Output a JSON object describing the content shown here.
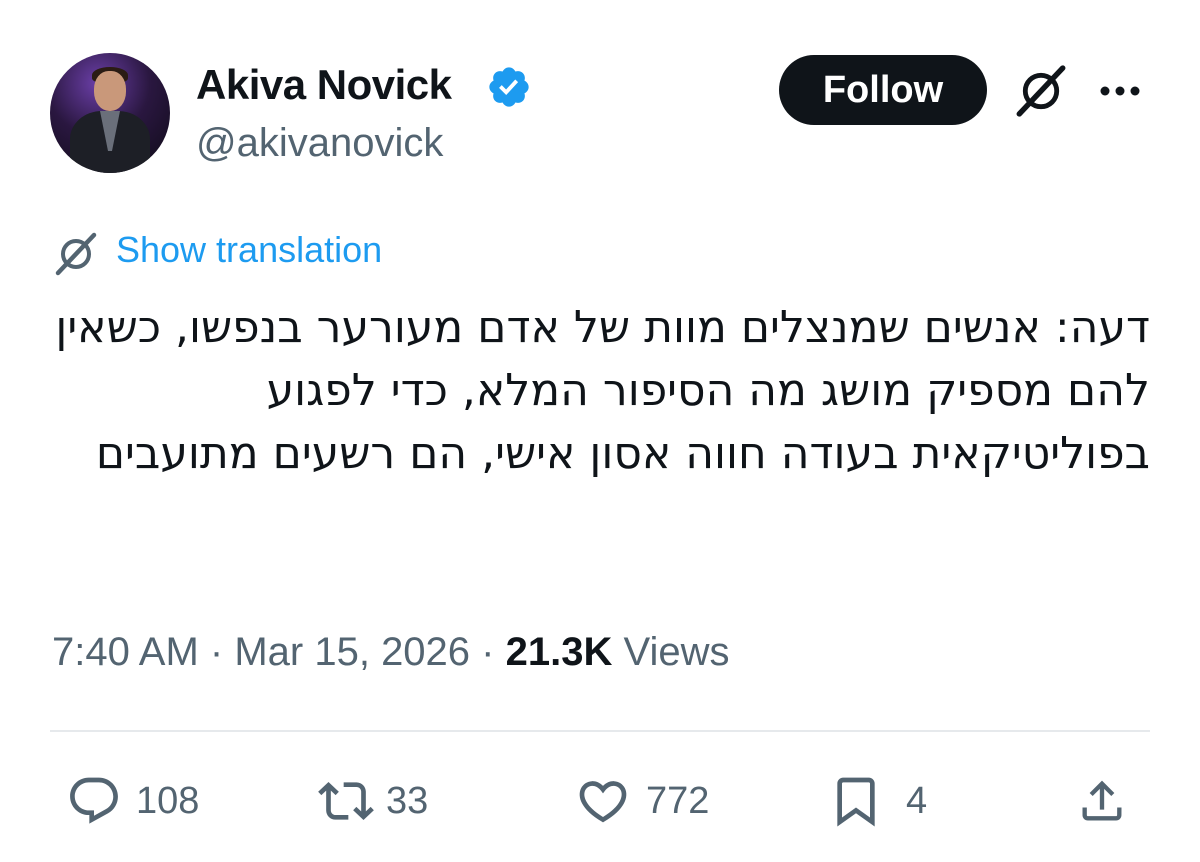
{
  "author": {
    "display_name": "Akiva Novick",
    "handle": "@akivanovick",
    "verified_color": "#1d9bf0"
  },
  "header": {
    "follow_label": "Follow"
  },
  "translation": {
    "label": "Show translation"
  },
  "tweet": {
    "text": "דעה: אנשים שמנצלים מוות של אדם מעורער בנפשו, כשאין להם מספיק מושג מה הסיפור המלא, כדי לפגוע בפוליטיקאית בעודה חווה אסון אישי, הם רשעים מתועבים"
  },
  "meta": {
    "time": "7:40 AM",
    "separator": "·",
    "date": "Mar 15, 2026",
    "views_count": "21.3K",
    "views_label": "Views"
  },
  "actions": {
    "replies": "108",
    "reposts": "33",
    "likes": "772",
    "bookmarks": "4"
  },
  "icons": {
    "verified": "verified-badge-icon",
    "grok": "grok-icon",
    "more": "more-icon",
    "reply": "reply-icon",
    "repost": "repost-icon",
    "like": "heart-icon",
    "bookmark": "bookmark-icon",
    "share": "share-icon"
  },
  "colors": {
    "accent": "#1d9bf0",
    "text_primary": "#0f1419",
    "text_secondary": "#536471",
    "button_bg": "#0f1419"
  }
}
